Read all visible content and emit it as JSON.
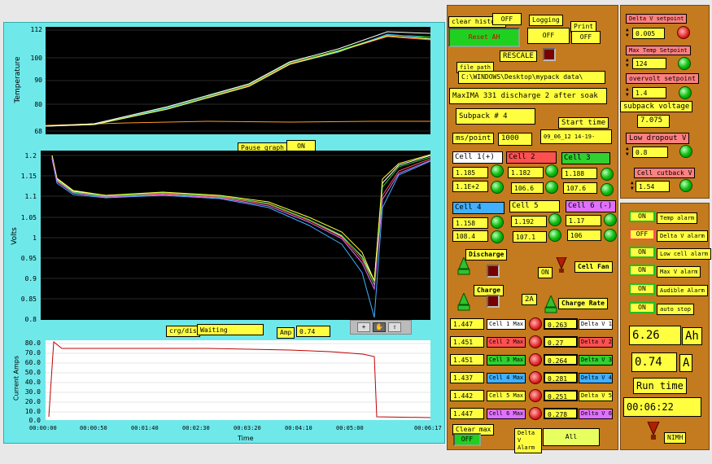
{
  "charts": {
    "temp": {
      "ylabel": "Temperature",
      "ticks": [
        "112",
        "100",
        "90",
        "80",
        "68"
      ]
    },
    "volts": {
      "ylabel": "Volts",
      "ticks": [
        "1.2",
        "1.15",
        "1.1",
        "1.05",
        "1",
        "0.95",
        "0.9",
        "0.85",
        "0.8"
      ]
    },
    "amps": {
      "ylabel": "Current Amps",
      "ticks": [
        "80.0",
        "70.0",
        "60.0",
        "50.0",
        "40.0",
        "30.0",
        "20.0",
        "10.0",
        "0.0"
      ],
      "xlabel": "Time",
      "xticks": [
        "00:00:00",
        "00:00:50",
        "00:01:40",
        "00:02:30",
        "00:03:20",
        "00:04:10",
        "00:05:00",
        "00:06:17"
      ]
    }
  },
  "pause_graph": {
    "label": "Pause graph",
    "value": "ON"
  },
  "crg_dis": {
    "label": "crg/dis",
    "value": "Waiting"
  },
  "amp": {
    "label": "Amp",
    "value": "0.74"
  },
  "clear_history": {
    "label": "clear history",
    "value": "OFF"
  },
  "logging": {
    "label": "Logging",
    "value": "OFF"
  },
  "print": {
    "label": "Print",
    "value": "OFF"
  },
  "reset_ah": "Reset AH",
  "rescale": "RESCALE",
  "file_path": {
    "label": "file path",
    "value": "C:\\WINDOWS\\Desktop\\mypack data\\"
  },
  "description": "MaxIMA 331 discharge 2 after soak",
  "subpack": "Subpack #  4",
  "start_time": {
    "label": "Start time",
    "value": "09_06_12   14-19-"
  },
  "ms_point": {
    "label": "ms/point",
    "value": "1000"
  },
  "cells": [
    {
      "name": "Cell 1(+)",
      "v": "1.185",
      "t": "1.1E+2",
      "color": "#ffffff"
    },
    {
      "name": "Cell 2",
      "v": "1.182",
      "t": "106.6",
      "color": "#ff5050"
    },
    {
      "name": "Cell 3",
      "v": "1.188",
      "t": "107.6",
      "color": "#30d030"
    },
    {
      "name": "Cell 4",
      "v": "1.158",
      "t": "108.4",
      "color": "#40b0ff"
    },
    {
      "name": "Cell 5",
      "v": "1.192",
      "t": "107.1",
      "color": "#ffff40"
    },
    {
      "name": "Cell 6 (-)",
      "v": "1.17",
      "t": "106",
      "color": "#e070ff"
    }
  ],
  "discharge": "Discharge",
  "charge": "Charge",
  "cell_fan": {
    "label": "Cell Fan",
    "value": "ON"
  },
  "charge_rate": {
    "label": "Charge Rate",
    "value": "2A"
  },
  "max_rows": [
    {
      "v": "1.447",
      "name": "Cell 1 Max",
      "d": "0.263",
      "dl": "Delta V 1",
      "color": "#ffffff"
    },
    {
      "v": "1.451",
      "name": "Cell 2 Max",
      "d": "0.27",
      "dl": "Delta V 2",
      "color": "#ff5050"
    },
    {
      "v": "1.451",
      "name": "Cell 3 Max",
      "d": "0.264",
      "dl": "Delta V 3",
      "color": "#30d030"
    },
    {
      "v": "1.437",
      "name": "Cell 4 Max",
      "d": "0.281",
      "dl": "Delta V 4",
      "color": "#40b0ff"
    },
    {
      "v": "1.442",
      "name": "Cell 5 Max",
      "d": "0.251",
      "dl": "Delta V 5",
      "color": "#ffff40"
    },
    {
      "v": "1.447",
      "name": "Cell 6 Max",
      "d": "0.278",
      "dl": "Delta V 6",
      "color": "#e070ff"
    }
  ],
  "clear_max": {
    "label": "Clear max",
    "value": "OFF"
  },
  "delta_v_alarm": {
    "label": "Delta V Alarm",
    "value": "All"
  },
  "setpoints": {
    "delta_v": {
      "label": "Delta V setpoint",
      "value": "0.005"
    },
    "max_temp": {
      "label": "Max Temp Setpoint",
      "value": "124"
    },
    "overvolt": {
      "label": "overvolt setpoint",
      "value": "1.4"
    },
    "subpack_voltage": {
      "label": "subpack voltage",
      "value": "7.075"
    },
    "low_dropout": {
      "label": "Low dropout V",
      "value": "0.8"
    },
    "cutback": {
      "label": "Cell cutback V",
      "value": "1.54"
    }
  },
  "alarms": [
    {
      "state": "ON",
      "label": "Temp alarm"
    },
    {
      "state": "OFF",
      "label": "Delta V alarm"
    },
    {
      "state": "ON",
      "label": "Low cell alarm"
    },
    {
      "state": "ON",
      "label": "Max V alarm"
    },
    {
      "state": "ON",
      "label": "Audible Alarm"
    },
    {
      "state": "ON",
      "label": "auto stop"
    }
  ],
  "ah": {
    "value": "6.26",
    "unit": "Ah"
  },
  "amps_display": {
    "value": "0.74",
    "unit": "A"
  },
  "run_time": {
    "label": "Run time",
    "value": "00:06:22"
  },
  "chem": "NIMH"
}
